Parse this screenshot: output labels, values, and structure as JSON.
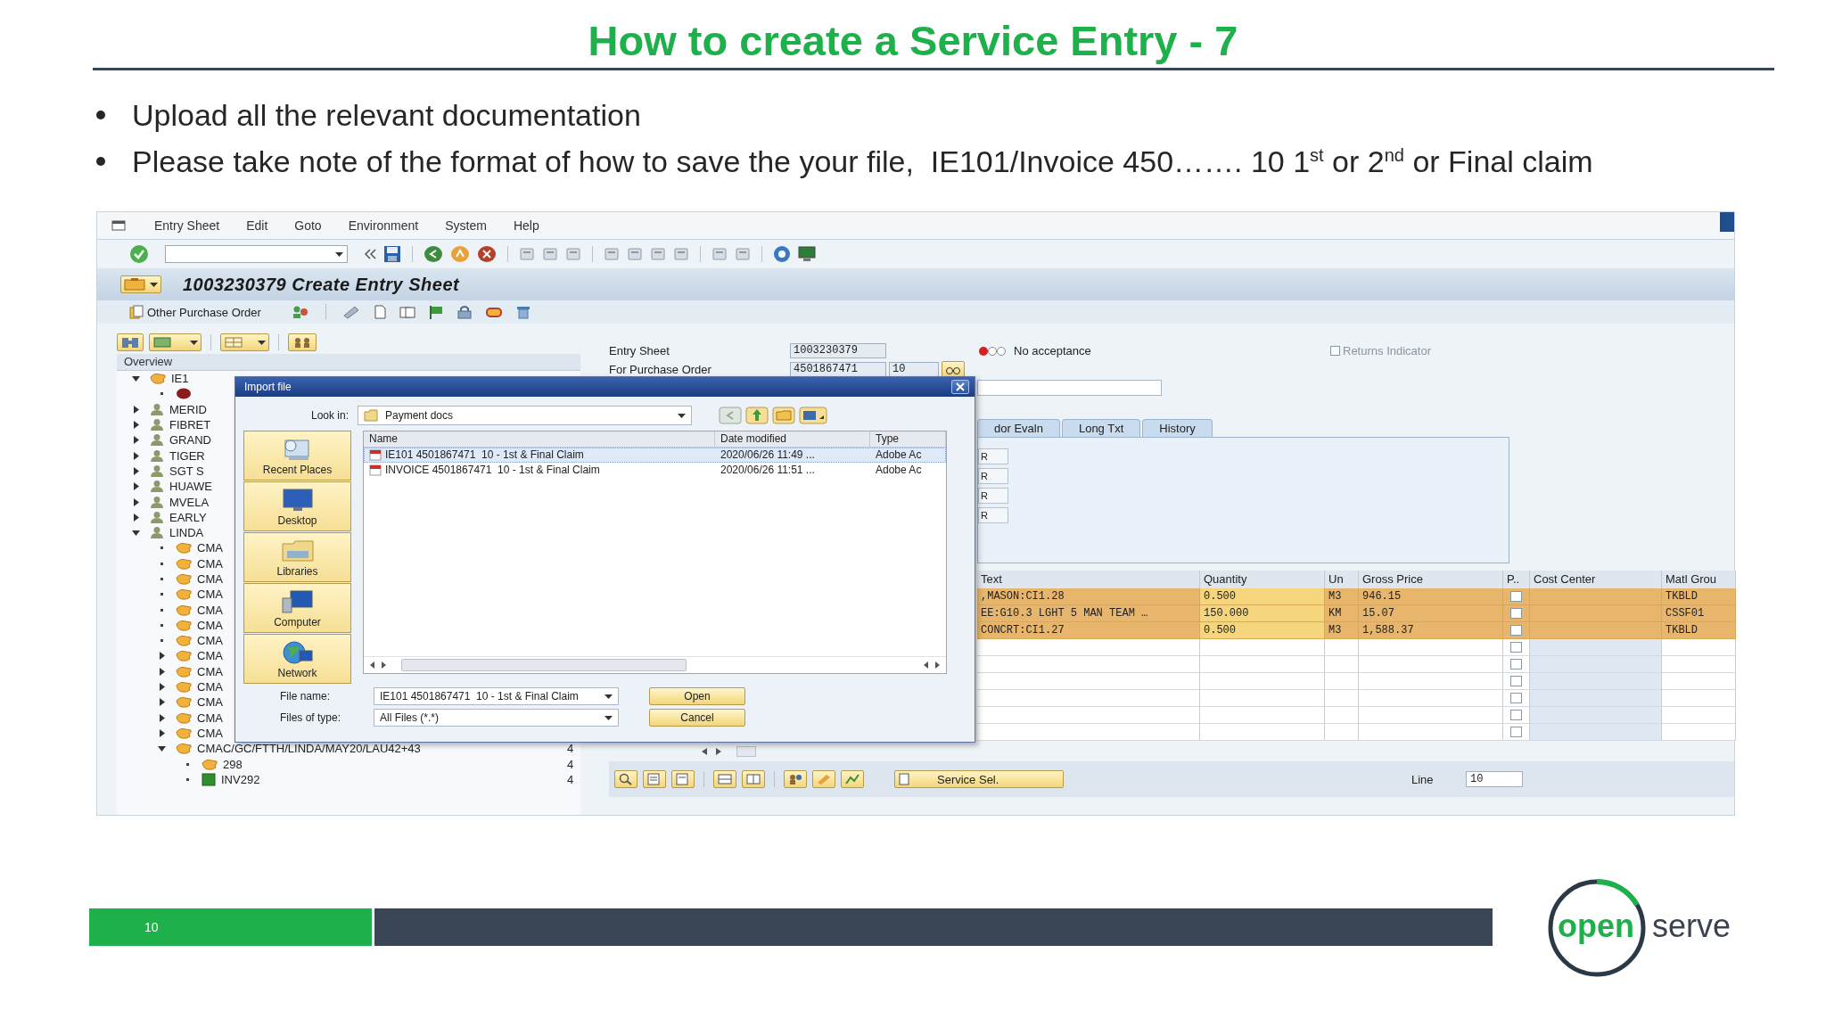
{
  "slide": {
    "title": "How to create a Service Entry - 7",
    "bullets": [
      "Upload all the relevant documentation",
      "Please take note of the format of how to save the your file,  IE101/Invoice 450……. 10 1$^{st}$ or 2$^{nd}$ or Final claim"
    ]
  },
  "sap": {
    "menu": [
      "Entry Sheet",
      "Edit",
      "Goto",
      "Environment",
      "System",
      "Help"
    ],
    "title": "1003230379 Create Entry Sheet",
    "app_toolbar": {
      "label": "Other Purchase Order"
    },
    "overview": {
      "header": "Overview",
      "tree": [
        {
          "label": "IE1",
          "kind": "entry",
          "expanded": true,
          "children": [
            {
              "kind": "status"
            }
          ]
        },
        {
          "label": "MERID",
          "kind": "vendor",
          "expanded": false
        },
        {
          "label": "FIBRET",
          "kind": "vendor",
          "expanded": false
        },
        {
          "label": "GRAND",
          "kind": "vendor",
          "expanded": false
        },
        {
          "label": "TIGER",
          "kind": "vendor",
          "expanded": false
        },
        {
          "label": "SGT S",
          "kind": "vendor",
          "expanded": false
        },
        {
          "label": "HUAWE",
          "kind": "vendor",
          "expanded": false
        },
        {
          "label": "MVELA",
          "kind": "vendor",
          "expanded": false
        },
        {
          "label": "EARLY",
          "kind": "vendor",
          "expanded": false
        },
        {
          "label": "LINDA",
          "kind": "vendor",
          "expanded": true,
          "children": [
            {
              "label": "CMA",
              "kind": "entry"
            },
            {
              "label": "CMA",
              "kind": "entry"
            },
            {
              "label": "CMA",
              "kind": "entry"
            },
            {
              "label": "CMA",
              "kind": "entry"
            },
            {
              "label": "CMA",
              "kind": "entry"
            },
            {
              "label": "CMA",
              "kind": "entry"
            },
            {
              "label": "CMA",
              "kind": "entry"
            },
            {
              "label": "CMA",
              "kind": "entry",
              "expanded": false
            },
            {
              "label": "CMA",
              "kind": "entry",
              "expanded": false
            },
            {
              "label": "CMA",
              "kind": "entry",
              "expanded": false
            },
            {
              "label": "CMA",
              "kind": "entry",
              "expanded": false
            },
            {
              "label": "CMA",
              "kind": "entry",
              "expanded": false
            },
            {
              "label": "CMA",
              "kind": "entry",
              "expanded": false
            },
            {
              "label": "CMAC/GC/FTTH/LINDA/MAY20/LAU42+43",
              "kind": "entry",
              "expanded": true,
              "count": "4",
              "children": [
                {
                  "label": "298",
                  "kind": "entry",
                  "count": "4"
                },
                {
                  "label": "INV292",
                  "kind": "doc",
                  "count": "4"
                }
              ]
            }
          ]
        }
      ]
    },
    "header": {
      "entry_sheet": {
        "label": "Entry Sheet",
        "value": "1003230379"
      },
      "acceptance": "No acceptance",
      "returns_indicator": {
        "label": "Returns Indicator",
        "checked": false,
        "disabled": true
      },
      "purchase_order": {
        "label": "For Purchase Order",
        "value": "4501867471",
        "item": "10"
      }
    },
    "tabs": [
      {
        "label": "dor Evaln",
        "selected": false
      },
      {
        "label": "Long Txt",
        "selected": false
      },
      {
        "label": "History",
        "selected": false
      }
    ],
    "tab_fields": [
      "R",
      "R",
      "R",
      "R"
    ],
    "table": {
      "columns": [
        "Text",
        "Quantity",
        "Un",
        "Gross Price",
        "P..",
        "Cost Center",
        "Matl Grou"
      ],
      "rows": [
        {
          "text": ",MASON:CI1.28",
          "quantity": "0.500",
          "unit": "M3",
          "gross_price": "946.15",
          "checked": false,
          "matl_group": "TKBLD",
          "selected": true
        },
        {
          "text": "EE:G10.3 LGHT 5 MAN TEAM …",
          "quantity": "150.000",
          "unit": "KM",
          "gross_price": "15.07",
          "checked": false,
          "matl_group": "CSSF01",
          "selected": true
        },
        {
          "text": "CONCRT:CI1.27",
          "quantity": "0.500",
          "unit": "M3",
          "gross_price": "1,588.37",
          "checked": false,
          "matl_group": "TKBLD",
          "selected": true
        },
        {
          "checked": false,
          "selected": false
        },
        {
          "checked": false,
          "selected": false
        },
        {
          "checked": false,
          "selected": false
        },
        {
          "checked": false,
          "selected": false
        },
        {
          "checked": false,
          "selected": false
        },
        {
          "checked": false,
          "selected": false
        }
      ]
    },
    "service_sel": "Service Sel.",
    "line": {
      "label": "Line",
      "value": "10"
    }
  },
  "dialog": {
    "title": "Import file",
    "look_in": {
      "label": "Look in:",
      "value": "Payment docs"
    },
    "places": [
      {
        "label": "Recent Places",
        "kind": "recent"
      },
      {
        "label": "Desktop",
        "kind": "desktop"
      },
      {
        "label": "Libraries",
        "kind": "libraries"
      },
      {
        "label": "Computer",
        "kind": "computer"
      },
      {
        "label": "Network",
        "kind": "network"
      }
    ],
    "columns": [
      "Name",
      "Date modified",
      "Type"
    ],
    "files": [
      {
        "name": "IE101 4501867471  10 - 1st & Final Claim",
        "date": "2020/06/26 11:49 ...",
        "type": "Adobe Ac",
        "selected": true
      },
      {
        "name": "INVOICE 4501867471  10 - 1st & Final Claim",
        "date": "2020/06/26 11:51 ...",
        "type": "Adobe Ac",
        "selected": false
      }
    ],
    "file_name": {
      "label": "File name:",
      "value": "IE101 4501867471  10 - 1st & Final Claim"
    },
    "file_type": {
      "label": "Files of type:",
      "value": "All Files (*.*)"
    },
    "buttons": [
      "Open",
      "Cancel"
    ]
  },
  "footer": {
    "page": "10",
    "logo": [
      "open",
      "serve"
    ]
  }
}
